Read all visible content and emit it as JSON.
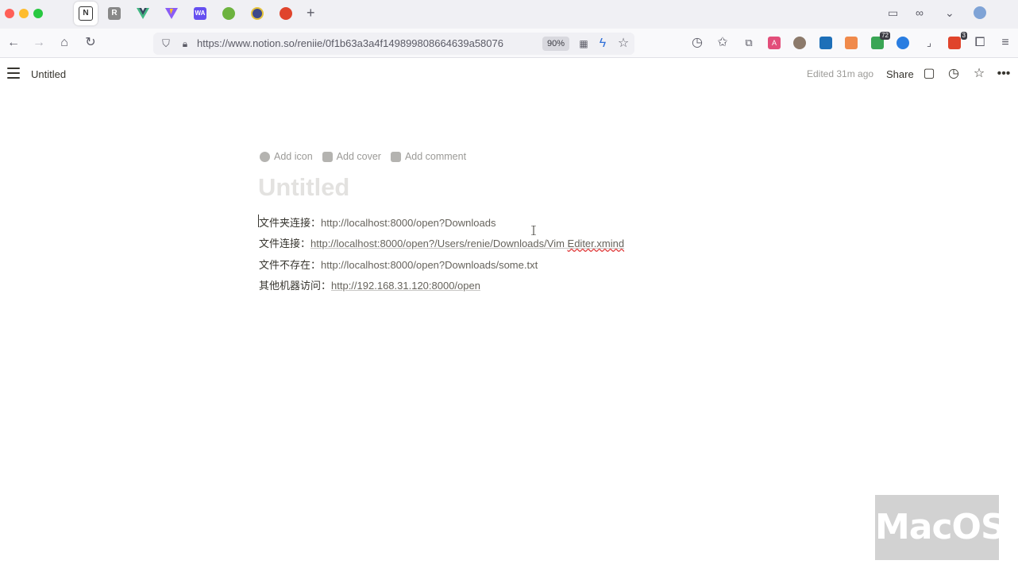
{
  "browser": {
    "url": "https://www.notion.so/reniie/0f1b63a3a4f149899808664639a58076",
    "zoom": "90%",
    "extension_badges": {
      "shield_count": "72",
      "gift_count": "3"
    },
    "tabs": [
      {
        "icon": "notion-icon",
        "color": "#ffffff",
        "active": true
      },
      {
        "icon": "regex-icon",
        "color": "#888888"
      },
      {
        "icon": "vue-icon",
        "color": "#41b883"
      },
      {
        "icon": "vite-icon",
        "color": "#8a5cf6"
      },
      {
        "icon": "webassembly-icon",
        "color": "#654ff0",
        "text": "WA"
      },
      {
        "icon": "spring-icon",
        "color": "#6db33f"
      },
      {
        "icon": "tool-icon",
        "color": "#3d4a8a"
      },
      {
        "icon": "globe-icon",
        "color": "#e0442c"
      }
    ]
  },
  "topbar": {
    "page_title": "Untitled",
    "edited": "Edited 31m ago",
    "share": "Share"
  },
  "page": {
    "actions": {
      "add_icon": "Add icon",
      "add_cover": "Add cover",
      "add_comment": "Add comment"
    },
    "title_placeholder": "Untitled",
    "lines": [
      {
        "label": "文件夹连接：",
        "link": "http://localhost:8000/open?Downloads",
        "underlined": false
      },
      {
        "label": "文件连接：",
        "link_prefix": "http://localhost:8000/open?/Users/renie/Downloads/Vim ",
        "link_suffix": "Editer.xmind",
        "underlined": true
      },
      {
        "label": "文件不存在：",
        "link": "http://localhost:8000/open?Downloads/some.txt",
        "underlined": false
      },
      {
        "label": "其他机器访问：",
        "link": "http://192.168.31.120:8000/open",
        "underlined": true
      }
    ]
  },
  "watermark": "MacOS"
}
